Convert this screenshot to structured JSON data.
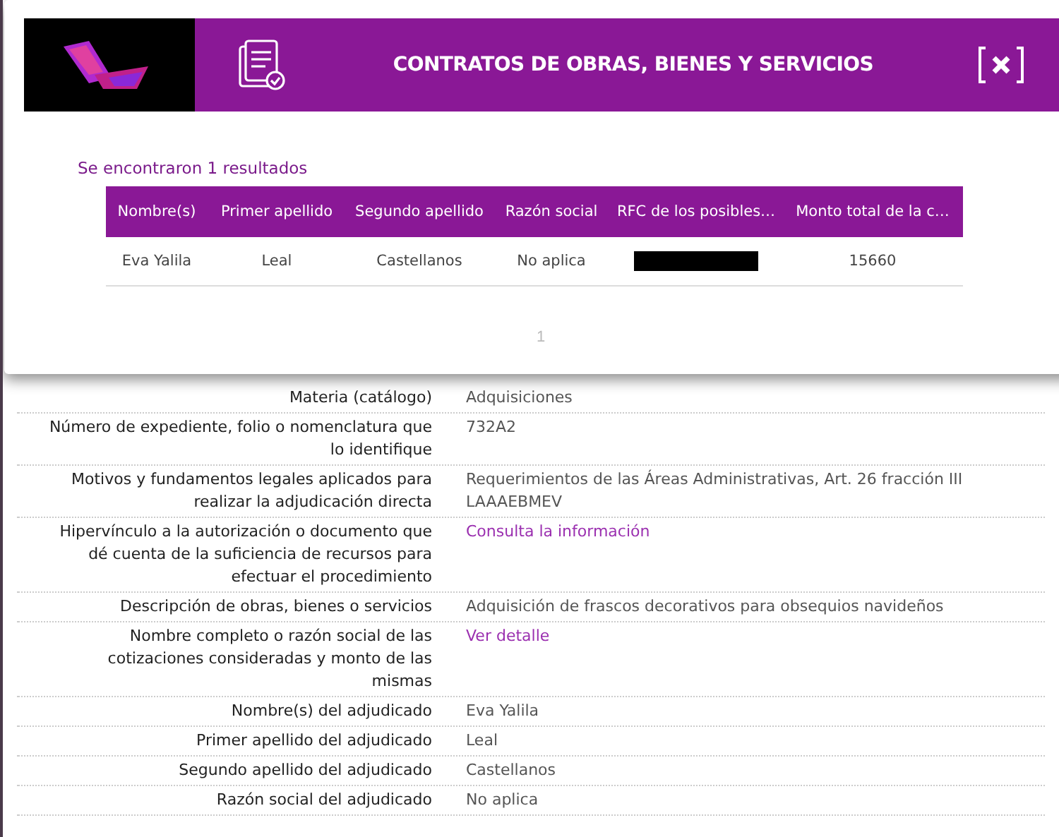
{
  "modal": {
    "title": "CONTRATOS DE OBRAS, BIENES Y SERVICIOS",
    "results_text": "Se encontraron 1 resultados",
    "table": {
      "columns": [
        "Nombre(s)",
        "Primer apellido",
        "Segundo apellido",
        "Razón social",
        "RFC de los posibles…",
        "Monto total de la c…"
      ],
      "rows": [
        [
          {
            "kind": "text",
            "text": "Eva Yalila"
          },
          {
            "kind": "text",
            "text": "Leal"
          },
          {
            "kind": "text",
            "text": "Castellanos"
          },
          {
            "kind": "text",
            "text": "No aplica"
          },
          {
            "kind": "redacted"
          },
          {
            "kind": "text",
            "text": "15660"
          }
        ]
      ]
    },
    "pagination": [
      {
        "label": "1",
        "selected": true
      }
    ]
  },
  "details": [
    {
      "label": "Materia (catálogo)",
      "value": "Adquisiciones",
      "kind": "text"
    },
    {
      "label": "Número de expediente, folio o nomenclatura que lo identifique",
      "value": "732A2",
      "kind": "text"
    },
    {
      "label": "Motivos y fundamentos legales aplicados para realizar la adjudicación directa",
      "value": "Requerimientos de las Áreas Administrativas, Art. 26 fracción III LAAAEBMEV",
      "kind": "text"
    },
    {
      "label": "Hipervínculo a la autorización o documento que dé cuenta de la suficiencia de recursos para efectuar el procedimiento",
      "value": "Consulta la información",
      "kind": "link"
    },
    {
      "label": "Descripción de obras, bienes o servicios",
      "value": "Adquisición de frascos decorativos para obsequios navideños",
      "kind": "text"
    },
    {
      "label": "Nombre completo o razón social de las cotizaciones consideradas y monto de las mismas",
      "value": "Ver detalle",
      "kind": "link"
    },
    {
      "label": "Nombre(s) del adjudicado",
      "value": "Eva Yalila",
      "kind": "text"
    },
    {
      "label": "Primer apellido del adjudicado",
      "value": "Leal",
      "kind": "text"
    },
    {
      "label": "Segundo apellido del adjudicado",
      "value": "Castellanos",
      "kind": "text"
    },
    {
      "label": "Razón social del adjudicado",
      "value": "No aplica",
      "kind": "text"
    }
  ]
}
